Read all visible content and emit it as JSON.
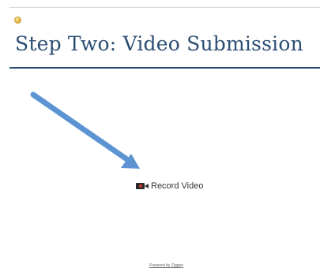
{
  "header": {
    "title": "Step Two: Video Submission",
    "title_color": "#2b4d73",
    "small_icon": "sun-icon"
  },
  "main": {
    "record_button": {
      "label": "Record Video",
      "icon": "video-camera-icon"
    },
    "annotation": {
      "icon": "arrow-icon",
      "color": "#5b93d3"
    }
  },
  "footer": {
    "powered_by": "Powered by Ziggeo"
  }
}
